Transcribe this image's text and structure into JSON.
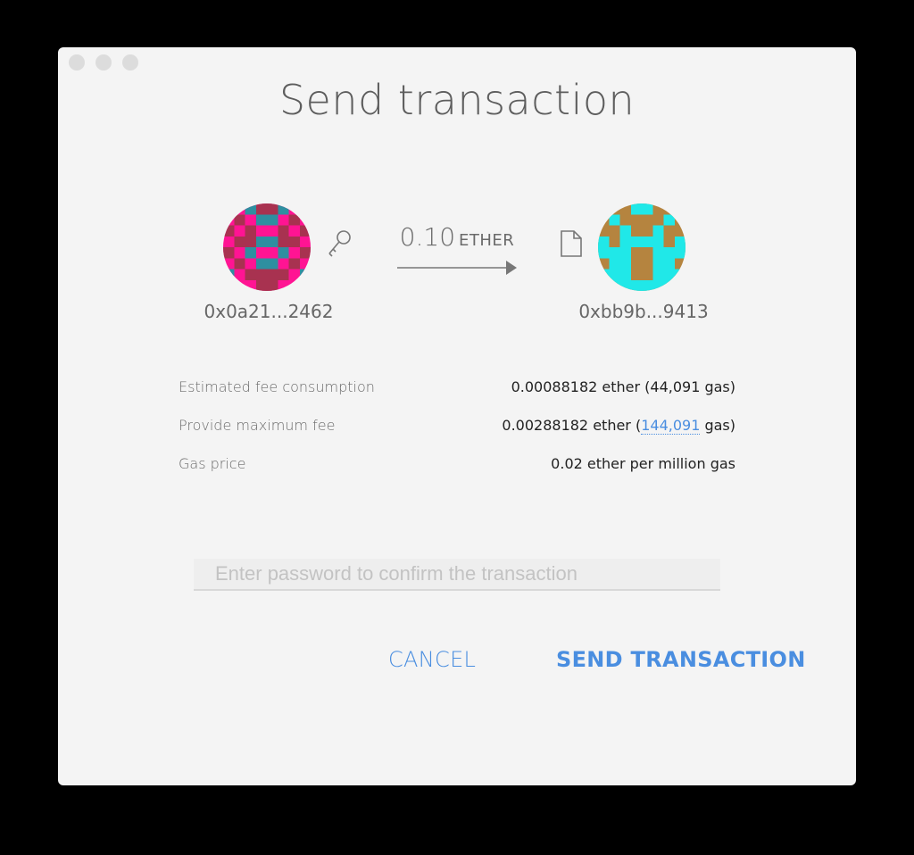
{
  "dialog": {
    "title": "Send transaction"
  },
  "from": {
    "address": "0x0a21...2462"
  },
  "to": {
    "address": "0xbb9b...9413"
  },
  "amount": {
    "value": "0.10",
    "unit": "ETHER"
  },
  "fees": {
    "estimated_label": "Estimated fee consumption",
    "estimated_value": "0.00088182 ether (44,091 gas)",
    "max_label": "Provide maximum fee",
    "max_value_prefix": "0.00288182 ether (",
    "max_gas": "144,091",
    "max_value_suffix": " gas)",
    "gas_price_label": "Gas price",
    "gas_price_value": "0.02 ether per million gas"
  },
  "password": {
    "placeholder": "Enter password to confirm the transaction",
    "value": ""
  },
  "buttons": {
    "cancel": "CANCEL",
    "send": "SEND TRANSACTION"
  },
  "colors": {
    "accent": "#4a8ee0",
    "from_identicon": [
      "#ff1493",
      "#a83250",
      "#2e8fa0"
    ],
    "to_identicon": [
      "#b5843f",
      "#20e8e8"
    ]
  }
}
